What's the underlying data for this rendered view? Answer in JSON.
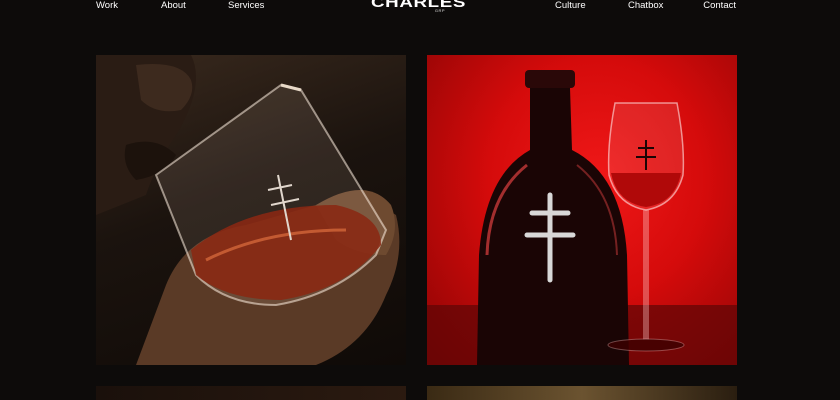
{
  "nav": {
    "left": [
      "Work",
      "About",
      "Services"
    ],
    "right": [
      "Culture",
      "Chatbox",
      "Contact"
    ]
  },
  "logo": {
    "word": "CHARLES",
    "sub": "GRP"
  },
  "gallery": [
    {
      "subject": "person sipping cognac from a tumbler glass"
    },
    {
      "subject": "cognac decanter and tulip glass on red backdrop"
    },
    {
      "subject": "dark brown photo (cropped)"
    },
    {
      "subject": "warm golden photo (cropped)"
    }
  ],
  "colors": {
    "background": "#0d0b0a",
    "accent_red": "#e01010",
    "text": "#ffffff"
  }
}
